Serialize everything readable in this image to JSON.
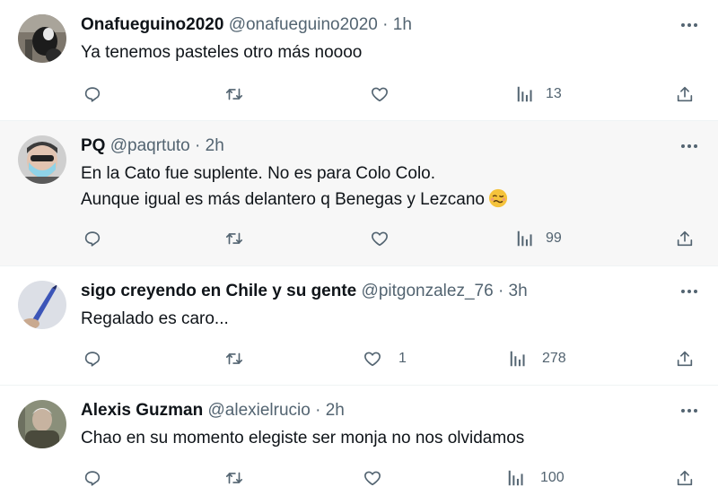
{
  "tweets": [
    {
      "name": "Onafueguino2020",
      "handle": "@onafueguino2020",
      "separator": "·",
      "time": "1h",
      "lines": [
        "Ya tenemos pasteles otro más noooo"
      ],
      "likes": "",
      "views": "13"
    },
    {
      "name": "PQ",
      "handle": "@paqrtuto",
      "separator": "·",
      "time": "2h",
      "lines": [
        "En la Cato fue suplente. No es para Colo Colo.",
        "Aunque igual es más delantero q Benegas y Lezcano"
      ],
      "likes": "",
      "views": "99"
    },
    {
      "name": "sigo creyendo en Chile y su gente",
      "handle": "@pitgonzalez_76",
      "separator": "·",
      "time": "3h",
      "lines": [
        "Regalado es caro..."
      ],
      "likes": "1",
      "views": "278"
    },
    {
      "name": "Alexis Guzman",
      "handle": "@alexielrucio",
      "separator": "·",
      "time": "2h",
      "lines": [
        "Chao en su momento elegiste ser monja no nos olvidamos"
      ],
      "likes": "",
      "views": "100"
    }
  ],
  "icons": {
    "reply": "reply-icon",
    "retweet": "retweet-icon",
    "like": "heart-icon",
    "views": "views-icon",
    "share": "share-icon",
    "more": "more-icon",
    "emoji": "woozy-face-emoji"
  },
  "colors": {
    "text": "#0f1419",
    "secondary": "#536471",
    "highlight_bg": "#f7f7f7"
  }
}
